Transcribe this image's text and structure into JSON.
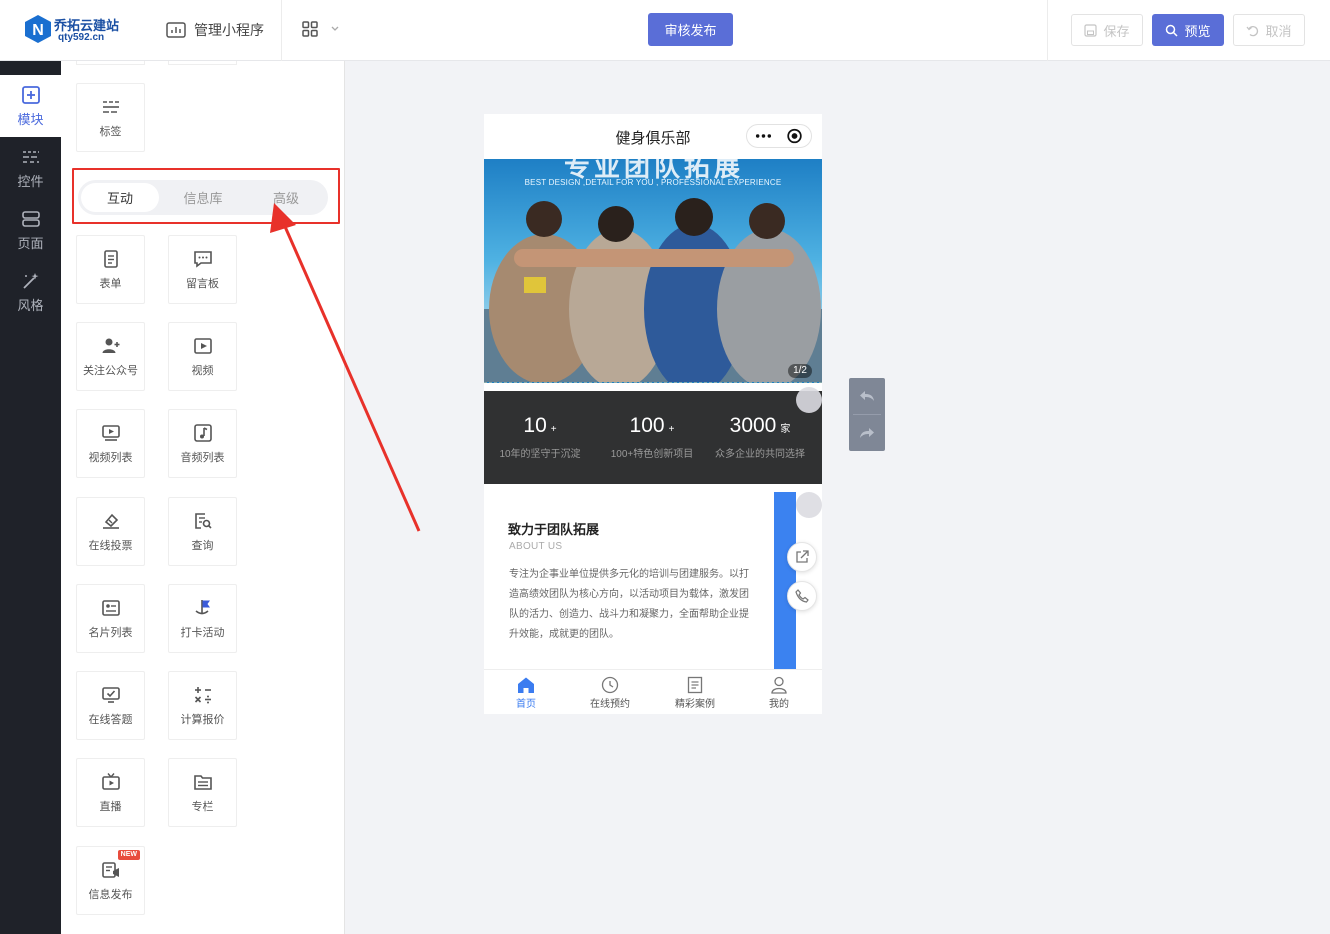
{
  "header": {
    "logo_name": "乔拓云建站",
    "logo_url": "qty592.cn",
    "manage_label": "管理小程序",
    "review_label": "审核发布",
    "save_label": "保存",
    "preview_label": "预览",
    "cancel_label": "取消"
  },
  "rail": {
    "items": [
      {
        "label": "模块",
        "icon": "plus-square-icon",
        "active": true
      },
      {
        "label": "控件",
        "icon": "sliders-icon",
        "active": false
      },
      {
        "label": "页面",
        "icon": "pages-icon",
        "active": false
      },
      {
        "label": "风格",
        "icon": "magic-wand-icon",
        "active": false
      }
    ]
  },
  "panel": {
    "top_tile": {
      "label": "标签",
      "icon": "tag-list-icon"
    },
    "tabs": [
      "互动",
      "信息库",
      "高级"
    ],
    "active_tab": "互动",
    "modules": [
      {
        "label": "表单",
        "icon": "form-icon"
      },
      {
        "label": "留言板",
        "icon": "message-board-icon"
      },
      {
        "label": "关注公众号",
        "icon": "follow-user-icon"
      },
      {
        "label": "视频",
        "icon": "video-icon"
      },
      {
        "label": "视频列表",
        "icon": "video-list-icon"
      },
      {
        "label": "音频列表",
        "icon": "audio-list-icon"
      },
      {
        "label": "在线投票",
        "icon": "vote-icon"
      },
      {
        "label": "查询",
        "icon": "query-icon"
      },
      {
        "label": "名片列表",
        "icon": "card-list-icon"
      },
      {
        "label": "打卡活动",
        "icon": "checkin-flag-icon"
      },
      {
        "label": "在线答题",
        "icon": "quiz-icon"
      },
      {
        "label": "计算报价",
        "icon": "calculator-icon"
      },
      {
        "label": "直播",
        "icon": "live-tv-icon"
      },
      {
        "label": "专栏",
        "icon": "column-icon"
      },
      {
        "label": "信息发布",
        "icon": "publish-info-icon",
        "badge": "NEW"
      }
    ]
  },
  "phone": {
    "title": "健身俱乐部",
    "banner_tagline": "BEST DESIGN ,DETAIL FOR YOU , PROFESSIONAL EXPERIENCE",
    "banner_page": "1/2",
    "stats": [
      {
        "num": "10",
        "unit": "+",
        "desc": "10年的坚守于沉淀"
      },
      {
        "num": "100",
        "unit": "+",
        "desc": "100+特色创新项目"
      },
      {
        "num": "3000",
        "unit": "家",
        "desc": "众多企业的共同选择"
      }
    ],
    "about": {
      "title": "致力于团队拓展",
      "subtitle": "ABOUT US",
      "text": "专注为企事业单位提供多元化的培训与团建服务。以打造高绩效团队为核心方向，以活动项目为载体，激发团队的活力、创造力、战斗力和凝聚力，全面帮助企业提升效能，成就更的团队。"
    },
    "tabbar": [
      {
        "label": "首页",
        "icon": "home-icon",
        "active": true
      },
      {
        "label": "在线预约",
        "icon": "clock-icon",
        "active": false
      },
      {
        "label": "精彩案例",
        "icon": "document-icon",
        "active": false
      },
      {
        "label": "我的",
        "icon": "user-icon",
        "active": false
      }
    ]
  },
  "colors": {
    "accent": "#5a6ed7",
    "rail_bg": "#1f2229",
    "highlight_red": "#e8312a",
    "tab_active_blue": "#3b7cf0"
  }
}
